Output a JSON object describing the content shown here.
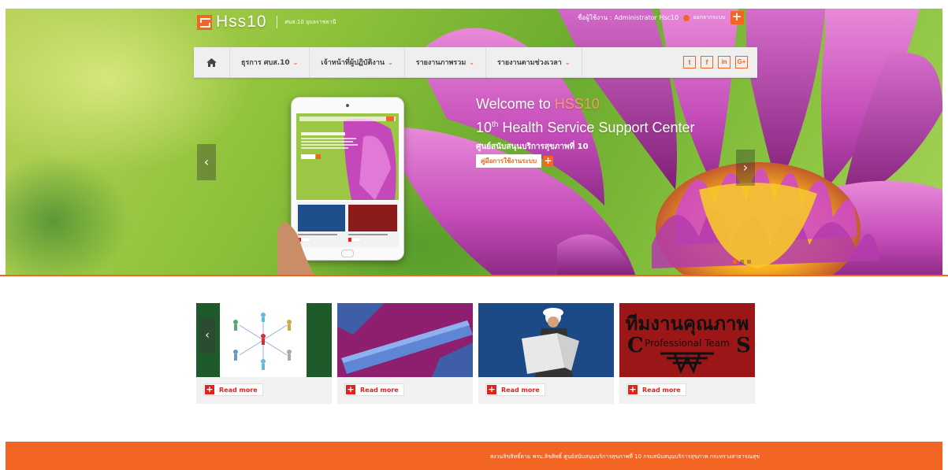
{
  "brand": {
    "name": "Hss10",
    "subtitle": "ศบส.10 อุบลราชธานี"
  },
  "user": {
    "prefix": "ชื่อผู้ใช้งาน :",
    "name": "Administrator Hsc10",
    "logout_label": "ออกจากระบบ",
    "plus_label": "+"
  },
  "nav": {
    "home_icon": "home-icon",
    "items": [
      {
        "label": "ธุรการ ศบส.10"
      },
      {
        "label": "เจ้าหน้าที่ผู้ปฏิบัติงาน"
      },
      {
        "label": "รายงานภาพรวม"
      },
      {
        "label": "รายงานตามช่วงเวลา"
      }
    ],
    "caret": "⌄",
    "social": [
      {
        "icon": "twitter-icon",
        "glyph": "t"
      },
      {
        "icon": "facebook-icon",
        "glyph": "f"
      },
      {
        "icon": "linkedin-icon",
        "glyph": "in"
      },
      {
        "icon": "google-plus-icon",
        "glyph": "G+"
      }
    ]
  },
  "slider": {
    "welcome_prefix": "Welcome to",
    "welcome_highlight": "HSS10",
    "center_prefix": "10",
    "center_sup": "th",
    "center_suffix": " Health Service Support Center",
    "center_th": "ศูนย์สนับสนุนบริการสุขภาพที่ 10",
    "manual_label": "คู่มือการใช้งานระบบ",
    "manual_plus": "+",
    "prev_arrow": "‹",
    "next_arrow": "›"
  },
  "cards": [
    {
      "image": "network-people-image",
      "read_more": "Read more"
    },
    {
      "image": "strategy-puzzle-image",
      "read_more": "Read more"
    },
    {
      "image": "engineer-blueprint-image",
      "read_more": "Read more"
    },
    {
      "image": "quality-team-image",
      "read_more": "Read more",
      "image_title": "ทีมงานคุณภาพ",
      "image_subtitle": "Professional Team"
    }
  ],
  "footer": {
    "text": "สงวนลิขสิทธิ์ตาม พรบ.ลิขสิทธิ์ ศูนย์สนับสนุนบริการสุขภาพที่ 10 กรมสนับสนุนบริการสุขภาพ กระทรวงสาธารณสุข"
  },
  "colors": {
    "accent": "#f26522",
    "card_bg": "#f1f1f1",
    "nav_bg": "#efefef"
  }
}
